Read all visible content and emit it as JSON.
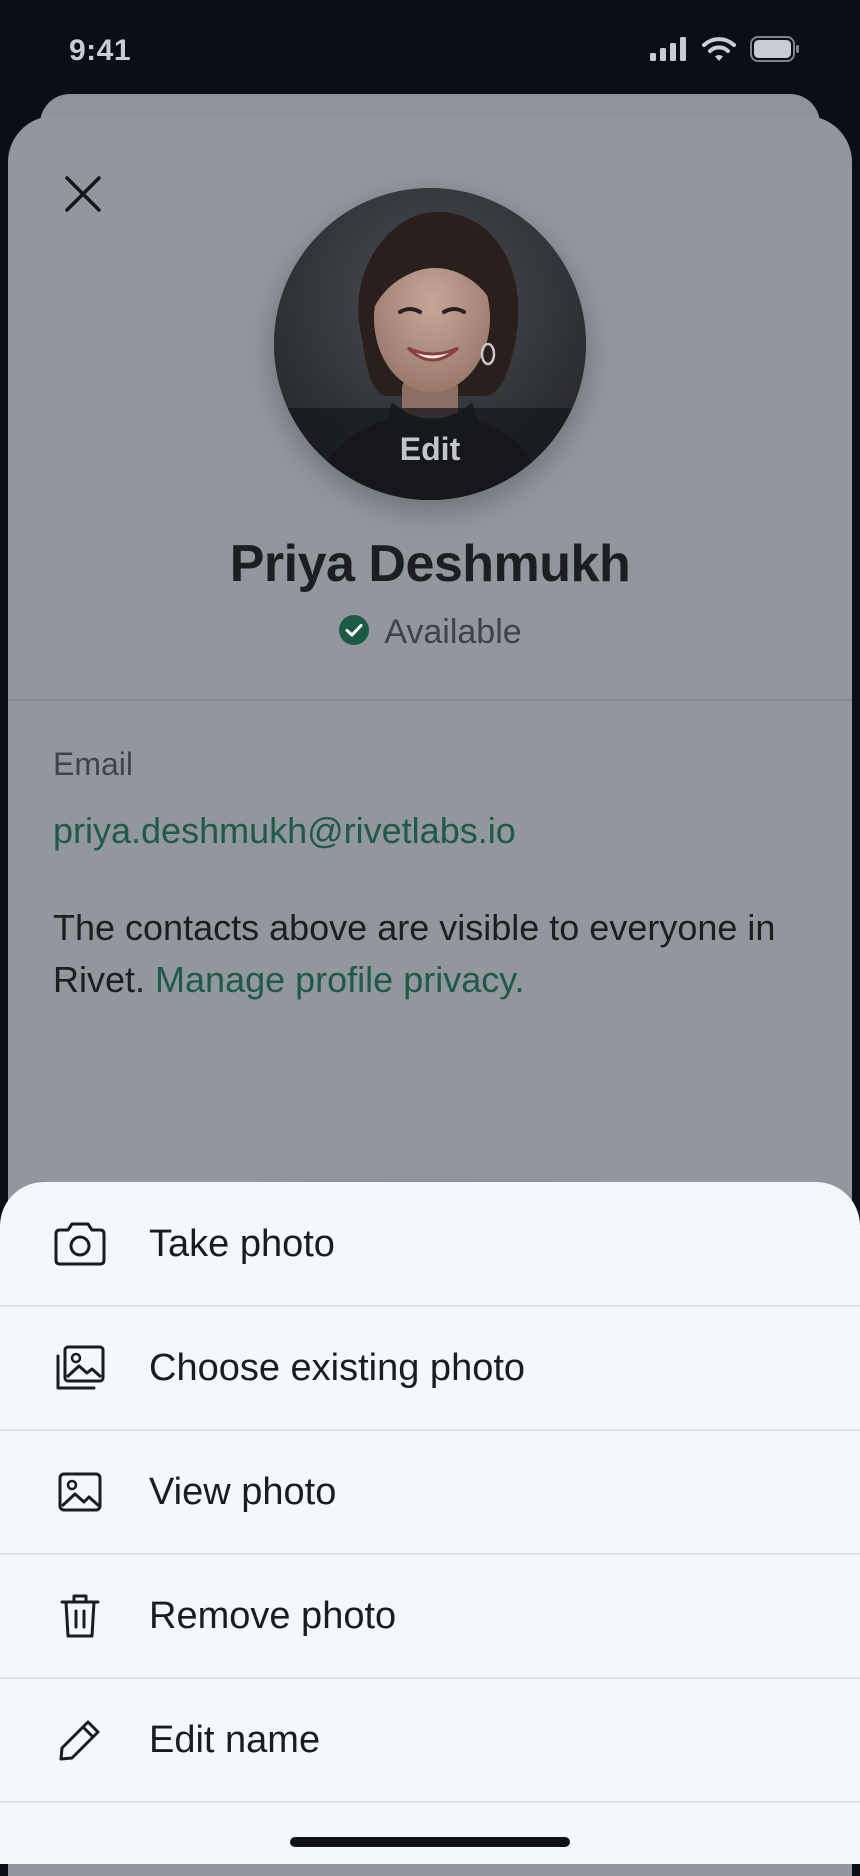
{
  "status_bar": {
    "time": "9:41"
  },
  "profile": {
    "avatar_edit_label": "Edit",
    "name": "Priya Deshmukh",
    "status": "Available",
    "email_label": "Email",
    "email": "priya.deshmukh@rivetlabs.io",
    "privacy_text": "The contacts above are visible to everyone in Rivet.",
    "privacy_link": "Manage profile privacy."
  },
  "action_sheet": {
    "items": [
      {
        "label": "Take photo",
        "icon": "camera-icon"
      },
      {
        "label": "Choose existing photo",
        "icon": "photo-library-icon"
      },
      {
        "label": "View photo",
        "icon": "image-icon"
      },
      {
        "label": "Remove photo",
        "icon": "trash-icon"
      },
      {
        "label": "Edit name",
        "icon": "pencil-icon"
      }
    ]
  },
  "colors": {
    "accent": "#1f5a47",
    "status_available": "#1d5a45",
    "sheet_background": "#f4f7fc",
    "dimmed_background": "#92969d"
  }
}
